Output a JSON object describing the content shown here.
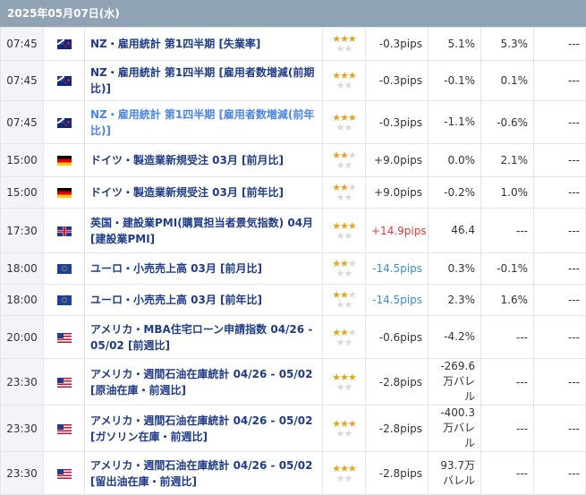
{
  "header": {
    "date": "2025年05月07日(水)"
  },
  "rows": [
    {
      "time": "07:45",
      "flag": "nz-flag-icon",
      "event": "NZ・雇用統計 第1四半期 [失業率]",
      "stars": 3,
      "pips": "-0.3pips",
      "pips_dir": "flat",
      "v1": "5.1%",
      "v2": "5.3%",
      "v3": "---"
    },
    {
      "time": "07:45",
      "flag": "nz-flag-icon",
      "event": "NZ・雇用統計 第1四半期 [雇用者数増減(前期比)]",
      "stars": 3,
      "pips": "-0.3pips",
      "pips_dir": "flat",
      "v1": "-0.1%",
      "v2": "0.1%",
      "v3": "---"
    },
    {
      "time": "07:45",
      "flag": "nz-flag-icon",
      "event": "NZ・雇用統計 第1四半期 [雇用者数増減(前年比)]",
      "stars": 3,
      "pips": "-0.3pips",
      "pips_dir": "flat",
      "v1": "-1.1%",
      "v2": "-0.6%",
      "v3": "---"
    },
    {
      "time": "15:00",
      "flag": "germany-flag-icon",
      "event": "ドイツ・製造業新規受注 03月 [前月比]",
      "stars": 2,
      "pips": "+9.0pips",
      "pips_dir": "flat",
      "v1": "0.0%",
      "v2": "2.1%",
      "v3": "---"
    },
    {
      "time": "15:00",
      "flag": "germany-flag-icon",
      "event": "ドイツ・製造業新規受注 03月 [前年比]",
      "stars": 2,
      "pips": "+9.0pips",
      "pips_dir": "flat",
      "v1": "-0.2%",
      "v2": "1.0%",
      "v3": "---"
    },
    {
      "time": "17:30",
      "flag": "uk-flag-icon",
      "event": "英国・建設業PMI(購買担当者景気指数) 04月 [建設業PMI]",
      "stars": 3,
      "pips": "+14.9pips",
      "pips_dir": "up",
      "v1": "46.4",
      "v2": "---",
      "v3": "---"
    },
    {
      "time": "18:00",
      "flag": "eu-flag-icon",
      "event": "ユーロ・小売売上高 03月 [前月比]",
      "stars": 2,
      "pips": "-14.5pips",
      "pips_dir": "down",
      "v1": "0.3%",
      "v2": "-0.1%",
      "v3": "---"
    },
    {
      "time": "18:00",
      "flag": "eu-flag-icon",
      "event": "ユーロ・小売売上高 03月 [前年比]",
      "stars": 2,
      "pips": "-14.5pips",
      "pips_dir": "down",
      "v1": "2.3%",
      "v2": "1.6%",
      "v3": "---"
    },
    {
      "time": "20:00",
      "flag": "us-flag-icon",
      "event": "アメリカ・MBA住宅ローン申請指数 04/26 - 05/02 [前週比]",
      "stars": 2,
      "pips": "-0.6pips",
      "pips_dir": "flat",
      "v1": "-4.2%",
      "v2": "---",
      "v3": "---"
    },
    {
      "time": "23:30",
      "flag": "us-flag-icon",
      "event": "アメリカ・週間石油在庫統計 04/26 - 05/02 [原油在庫・前週比]",
      "stars": 3,
      "pips": "-2.8pips",
      "pips_dir": "flat",
      "v1": "-269.6万バレル",
      "v2": "---",
      "v3": "---"
    },
    {
      "time": "23:30",
      "flag": "us-flag-icon",
      "event": "アメリカ・週間石油在庫統計 04/26 - 05/02 [ガソリン在庫・前週比]",
      "stars": 3,
      "pips": "-2.8pips",
      "pips_dir": "flat",
      "v1": "-400.3万バレル",
      "v2": "---",
      "v3": "---"
    },
    {
      "time": "23:30",
      "flag": "us-flag-icon",
      "event": "アメリカ・週間石油在庫統計 04/26 - 05/02 [留出油在庫・前週比]",
      "stars": 3,
      "pips": "-2.8pips",
      "pips_dir": "flat",
      "v1": "93.7万バレル",
      "v2": "---",
      "v3": "---"
    }
  ]
}
